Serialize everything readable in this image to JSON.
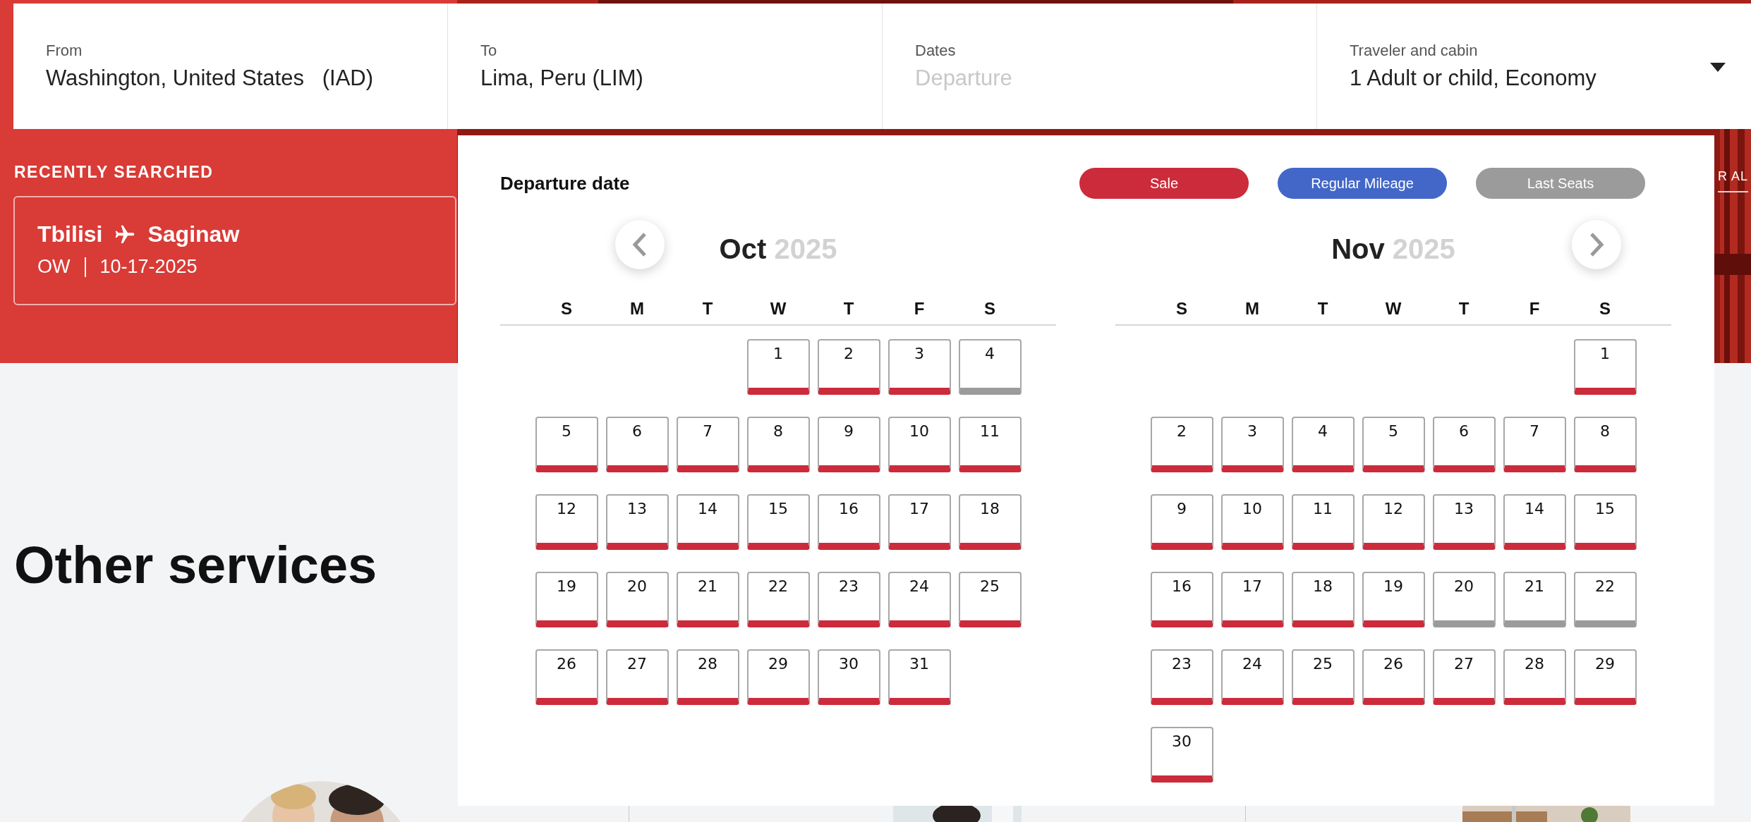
{
  "search_bar": {
    "fields": [
      {
        "label": "From",
        "value": "Washington, United States   (IAD)"
      },
      {
        "label": "To",
        "value": "Lima, Peru (LIM)"
      },
      {
        "label": "Dates",
        "placeholder": "Departure"
      },
      {
        "label": "Traveler and cabin",
        "value": "1 Adult or child, Economy",
        "kind": "dropdown"
      }
    ]
  },
  "recently_searched": {
    "heading": "RECENTLY SEARCHED",
    "items": [
      {
        "origin": "Tbilisi",
        "destination": "Saginaw",
        "trip_type": "OW",
        "date": "10-17-2025"
      }
    ]
  },
  "hero_link": "R AL",
  "other_services": {
    "heading": "Other services"
  },
  "calendar": {
    "title": "Departure date",
    "legend": [
      {
        "label": "Sale",
        "kind": "sale",
        "color": "#cc2b3b"
      },
      {
        "label": "Regular Mileage",
        "kind": "regular",
        "color": "#4267c8"
      },
      {
        "label": "Last Seats",
        "kind": "last_seats",
        "color": "#9b9b9b"
      }
    ],
    "months": [
      {
        "month": "Oct",
        "year": "2025",
        "weekdays": [
          "S",
          "M",
          "T",
          "W",
          "T",
          "F",
          "S"
        ],
        "weeks": [
          [
            {
              "kind": "empty"
            },
            {
              "kind": "empty"
            },
            {
              "kind": "empty"
            },
            {
              "label": "1",
              "kind": "sale"
            },
            {
              "label": "2",
              "kind": "sale"
            },
            {
              "label": "3",
              "kind": "sale"
            },
            {
              "label": "4",
              "kind": "last_seats"
            }
          ],
          [
            {
              "label": "5",
              "kind": "sale"
            },
            {
              "label": "6",
              "kind": "sale"
            },
            {
              "label": "7",
              "kind": "sale"
            },
            {
              "label": "8",
              "kind": "sale"
            },
            {
              "label": "9",
              "kind": "sale"
            },
            {
              "label": "10",
              "kind": "sale"
            },
            {
              "label": "11",
              "kind": "sale"
            }
          ],
          [
            {
              "label": "12",
              "kind": "sale"
            },
            {
              "label": "13",
              "kind": "sale"
            },
            {
              "label": "14",
              "kind": "sale"
            },
            {
              "label": "15",
              "kind": "sale"
            },
            {
              "label": "16",
              "kind": "sale"
            },
            {
              "label": "17",
              "kind": "sale"
            },
            {
              "label": "18",
              "kind": "sale"
            }
          ],
          [
            {
              "label": "19",
              "kind": "sale"
            },
            {
              "label": "20",
              "kind": "sale"
            },
            {
              "label": "21",
              "kind": "sale"
            },
            {
              "label": "22",
              "kind": "sale"
            },
            {
              "label": "23",
              "kind": "sale"
            },
            {
              "label": "24",
              "kind": "sale"
            },
            {
              "label": "25",
              "kind": "sale"
            }
          ],
          [
            {
              "label": "26",
              "kind": "sale"
            },
            {
              "label": "27",
              "kind": "sale"
            },
            {
              "label": "28",
              "kind": "sale"
            },
            {
              "label": "29",
              "kind": "sale"
            },
            {
              "label": "30",
              "kind": "sale"
            },
            {
              "label": "31",
              "kind": "sale"
            },
            {
              "kind": "empty"
            }
          ]
        ]
      },
      {
        "month": "Nov",
        "year": "2025",
        "weekdays": [
          "S",
          "M",
          "T",
          "W",
          "T",
          "F",
          "S"
        ],
        "weeks": [
          [
            {
              "kind": "empty"
            },
            {
              "kind": "empty"
            },
            {
              "kind": "empty"
            },
            {
              "kind": "empty"
            },
            {
              "kind": "empty"
            },
            {
              "kind": "empty"
            },
            {
              "label": "1",
              "kind": "sale"
            }
          ],
          [
            {
              "label": "2",
              "kind": "sale"
            },
            {
              "label": "3",
              "kind": "sale"
            },
            {
              "label": "4",
              "kind": "sale"
            },
            {
              "label": "5",
              "kind": "sale"
            },
            {
              "label": "6",
              "kind": "sale"
            },
            {
              "label": "7",
              "kind": "sale"
            },
            {
              "label": "8",
              "kind": "sale"
            }
          ],
          [
            {
              "label": "9",
              "kind": "sale"
            },
            {
              "label": "10",
              "kind": "sale"
            },
            {
              "label": "11",
              "kind": "sale"
            },
            {
              "label": "12",
              "kind": "sale"
            },
            {
              "label": "13",
              "kind": "sale"
            },
            {
              "label": "14",
              "kind": "sale"
            },
            {
              "label": "15",
              "kind": "sale"
            }
          ],
          [
            {
              "label": "16",
              "kind": "sale"
            },
            {
              "label": "17",
              "kind": "sale"
            },
            {
              "label": "18",
              "kind": "sale"
            },
            {
              "label": "19",
              "kind": "sale"
            },
            {
              "label": "20",
              "kind": "last_seats"
            },
            {
              "label": "21",
              "kind": "last_seats"
            },
            {
              "label": "22",
              "kind": "last_seats"
            }
          ],
          [
            {
              "label": "23",
              "kind": "sale"
            },
            {
              "label": "24",
              "kind": "sale"
            },
            {
              "label": "25",
              "kind": "sale"
            },
            {
              "label": "26",
              "kind": "sale"
            },
            {
              "label": "27",
              "kind": "sale"
            },
            {
              "label": "28",
              "kind": "sale"
            },
            {
              "label": "29",
              "kind": "sale"
            }
          ],
          [
            {
              "label": "30",
              "kind": "sale"
            },
            {
              "kind": "empty"
            },
            {
              "kind": "empty"
            },
            {
              "kind": "empty"
            },
            {
              "kind": "empty"
            },
            {
              "kind": "empty"
            },
            {
              "kind": "empty"
            }
          ]
        ]
      }
    ]
  }
}
